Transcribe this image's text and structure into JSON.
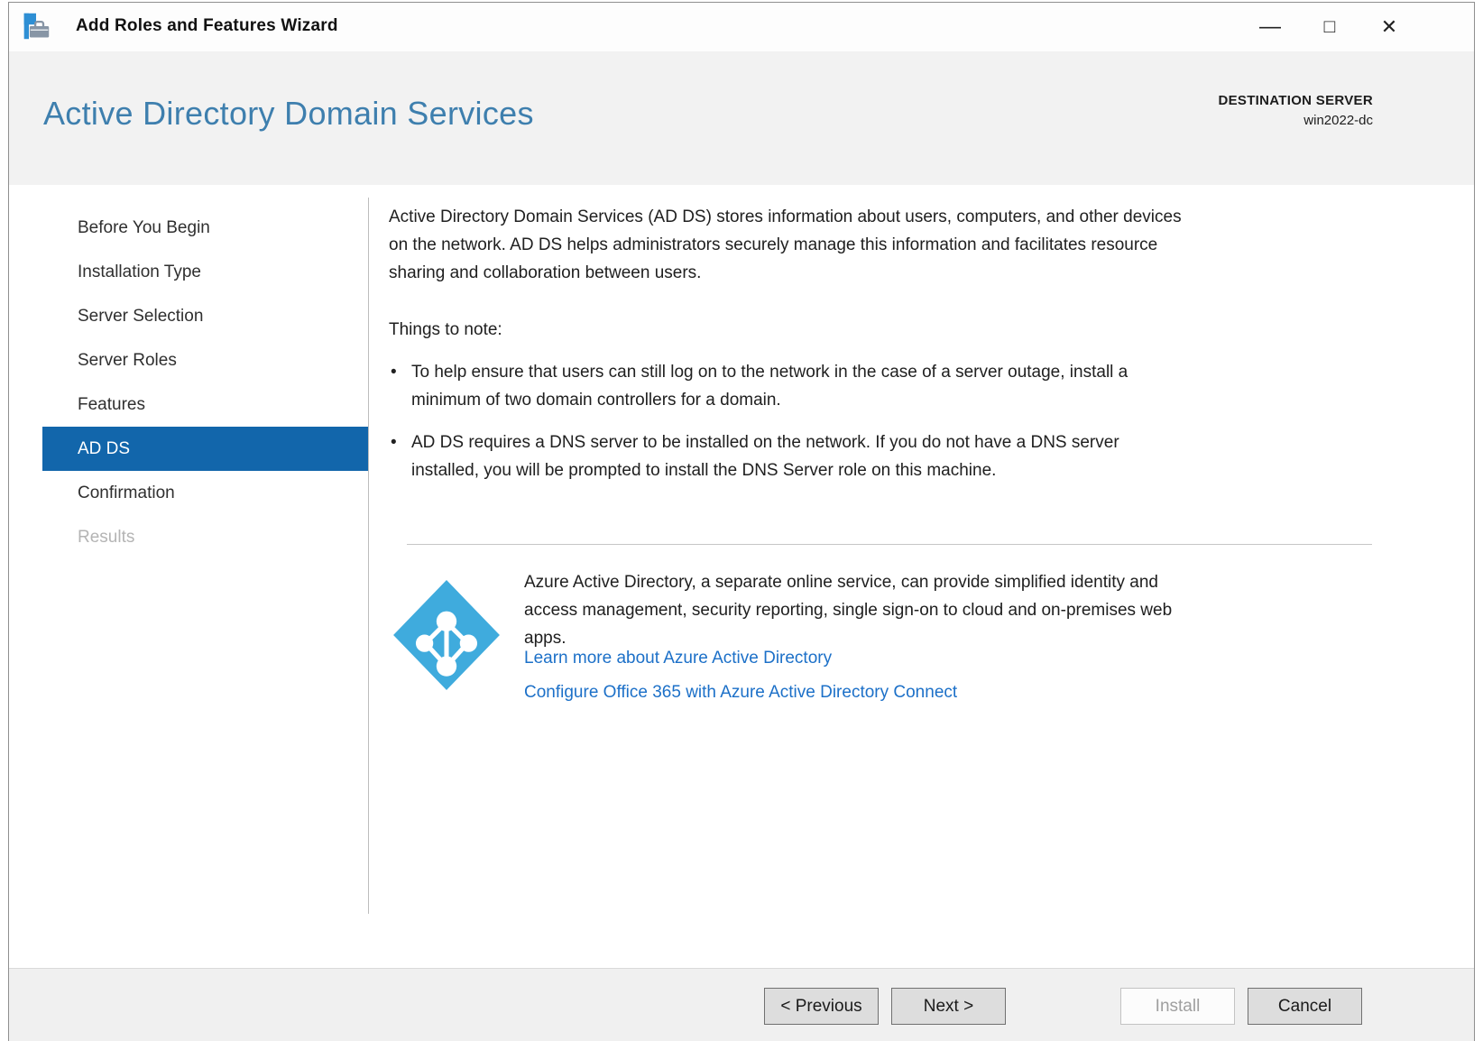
{
  "window": {
    "title": "Add Roles and Features Wizard",
    "controls": {
      "minimize": "—",
      "maximize": "□",
      "close": "✕"
    }
  },
  "header": {
    "page_title": "Active Directory Domain Services",
    "destination_label": "DESTINATION SERVER",
    "destination_server": "win2022-dc"
  },
  "sidebar": {
    "items": [
      {
        "label": "Before You Begin",
        "state": "normal"
      },
      {
        "label": "Installation Type",
        "state": "normal"
      },
      {
        "label": "Server Selection",
        "state": "normal"
      },
      {
        "label": "Server Roles",
        "state": "normal"
      },
      {
        "label": "Features",
        "state": "normal"
      },
      {
        "label": "AD DS",
        "state": "selected"
      },
      {
        "label": "Confirmation",
        "state": "normal"
      },
      {
        "label": "Results",
        "state": "disabled"
      }
    ]
  },
  "content": {
    "intro_lines": [
      "Active Directory Domain Services (AD DS) stores information about users, computers, and other devices",
      "on the network.  AD DS helps administrators securely manage this information and facilitates resource",
      "sharing and collaboration between users."
    ],
    "note_heading": "Things to note:",
    "bullet_char": "•",
    "bullets": [
      {
        "lines": [
          "To help ensure that users can still log on to the network in the case of a server outage, install a",
          "minimum of two domain controllers for a domain."
        ]
      },
      {
        "lines": [
          "AD DS requires a DNS server to be installed on the network.  If you do not have a DNS server",
          "installed, you will be prompted to install the DNS Server role on this machine."
        ]
      }
    ],
    "azure": {
      "icon_name": "azure-active-directory-icon",
      "desc_lines": [
        "Azure Active Directory, a separate online service, can provide simplified identity and",
        "access management, security reporting, single sign-on to cloud and on-premises web",
        "apps."
      ],
      "links": [
        "Learn more about Azure Active Directory",
        "Configure Office 365 with Azure Active Directory Connect"
      ]
    }
  },
  "footer": {
    "previous_label": "< Previous",
    "next_label": "Next >",
    "install_label": "Install",
    "cancel_label": "Cancel"
  },
  "colors": {
    "selection_blue": "#1266ab",
    "heading_blue": "#3e7fae",
    "azure_icon_blue": "#3fabdd",
    "link_blue": "#1c70c8",
    "footer_gray": "#f0f0f0"
  }
}
